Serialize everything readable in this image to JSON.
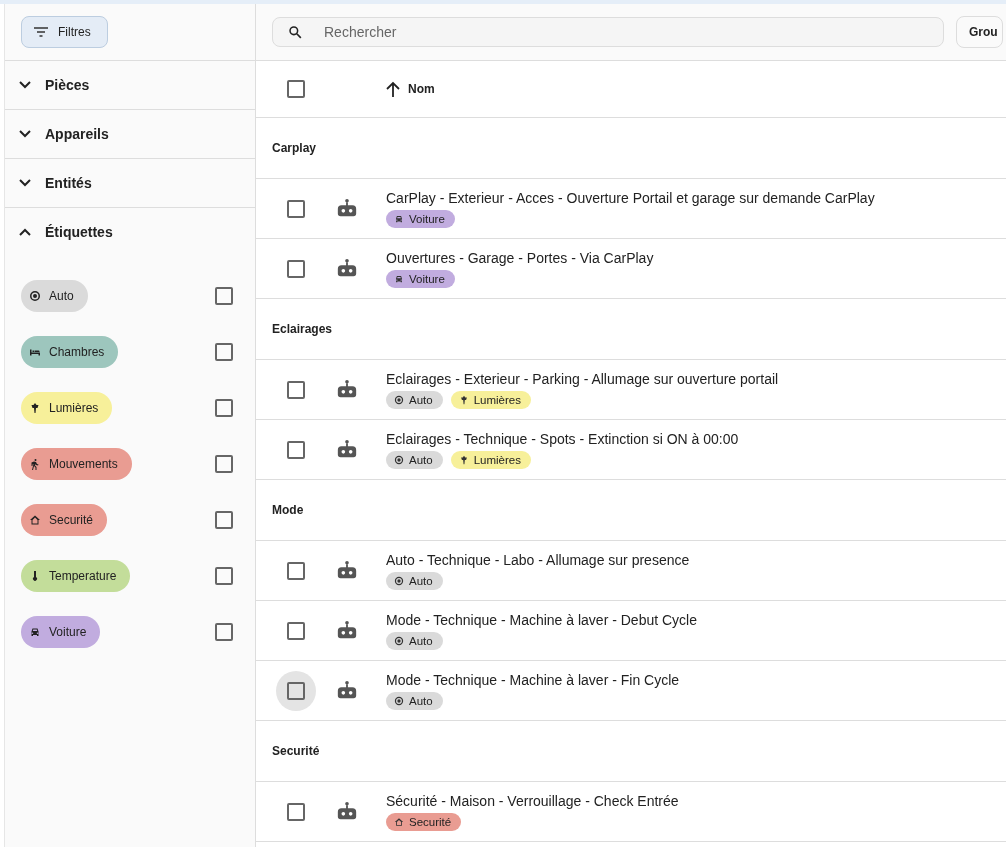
{
  "sidebar": {
    "filter_button": "Filtres",
    "sections": [
      {
        "title": "Pièces",
        "expanded": false
      },
      {
        "title": "Appareils",
        "expanded": false
      },
      {
        "title": "Entités",
        "expanded": false
      },
      {
        "title": "Étiquettes",
        "expanded": true
      }
    ],
    "labels": [
      {
        "name": "Auto",
        "kind": "auto",
        "color": "#dadada",
        "checked": false
      },
      {
        "name": "Chambres",
        "kind": "bed",
        "color": "#9dc6bd",
        "checked": false
      },
      {
        "name": "Lumières",
        "kind": "lamp",
        "color": "#f7f09a",
        "checked": false
      },
      {
        "name": "Mouvements",
        "kind": "walk",
        "color": "#e99c92",
        "checked": false
      },
      {
        "name": "Securité",
        "kind": "house",
        "color": "#e99c92",
        "checked": false
      },
      {
        "name": "Temperature",
        "kind": "thermo",
        "color": "#c3dd9a",
        "checked": false
      },
      {
        "name": "Voiture",
        "kind": "car",
        "color": "#c1acdf",
        "checked": false
      }
    ]
  },
  "toolbar": {
    "search": {
      "placeholder": "Rechercher"
    },
    "group_button": "Grou"
  },
  "table": {
    "header": {
      "checked": false,
      "column": "Nom"
    },
    "groups": [
      {
        "title": "Carplay",
        "rows": [
          {
            "name": "CarPlay - Exterieur - Acces - Ouverture Portail et garage sur demande CarPlay",
            "checked": false,
            "highlighted": false,
            "tags": [
              {
                "text": "Voiture",
                "kind": "car",
                "color": "#c1acdf"
              }
            ]
          },
          {
            "name": "Ouvertures - Garage - Portes - Via CarPlay",
            "checked": false,
            "highlighted": false,
            "tags": [
              {
                "text": "Voiture",
                "kind": "car",
                "color": "#c1acdf"
              }
            ]
          }
        ]
      },
      {
        "title": "Eclairages",
        "rows": [
          {
            "name": "Eclairages - Exterieur - Parking - Allumage sur ouverture portail",
            "checked": false,
            "highlighted": false,
            "tags": [
              {
                "text": "Auto",
                "kind": "auto",
                "color": "#dadada"
              },
              {
                "text": "Lumières",
                "kind": "lamp",
                "color": "#f7f09a"
              }
            ]
          },
          {
            "name": "Eclairages - Technique - Spots - Extinction si ON à 00:00",
            "checked": false,
            "highlighted": false,
            "tags": [
              {
                "text": "Auto",
                "kind": "auto",
                "color": "#dadada"
              },
              {
                "text": "Lumières",
                "kind": "lamp",
                "color": "#f7f09a"
              }
            ]
          }
        ]
      },
      {
        "title": "Mode",
        "rows": [
          {
            "name": "Auto - Technique - Labo - Allumage sur presence",
            "checked": false,
            "highlighted": false,
            "tags": [
              {
                "text": "Auto",
                "kind": "auto",
                "color": "#dadada"
              }
            ]
          },
          {
            "name": "Mode - Technique - Machine à laver - Debut Cycle",
            "checked": false,
            "highlighted": false,
            "tags": [
              {
                "text": "Auto",
                "kind": "auto",
                "color": "#dadada"
              }
            ]
          },
          {
            "name": "Mode - Technique - Machine à laver - Fin Cycle",
            "checked": false,
            "highlighted": true,
            "tags": [
              {
                "text": "Auto",
                "kind": "auto",
                "color": "#dadada"
              }
            ]
          }
        ]
      },
      {
        "title": "Securité",
        "rows": [
          {
            "name": "Sécurité - Maison - Verrouillage - Check Entrée",
            "checked": false,
            "highlighted": false,
            "tags": [
              {
                "text": "Securité",
                "kind": "house",
                "color": "#e99c92"
              }
            ]
          }
        ]
      }
    ]
  }
}
